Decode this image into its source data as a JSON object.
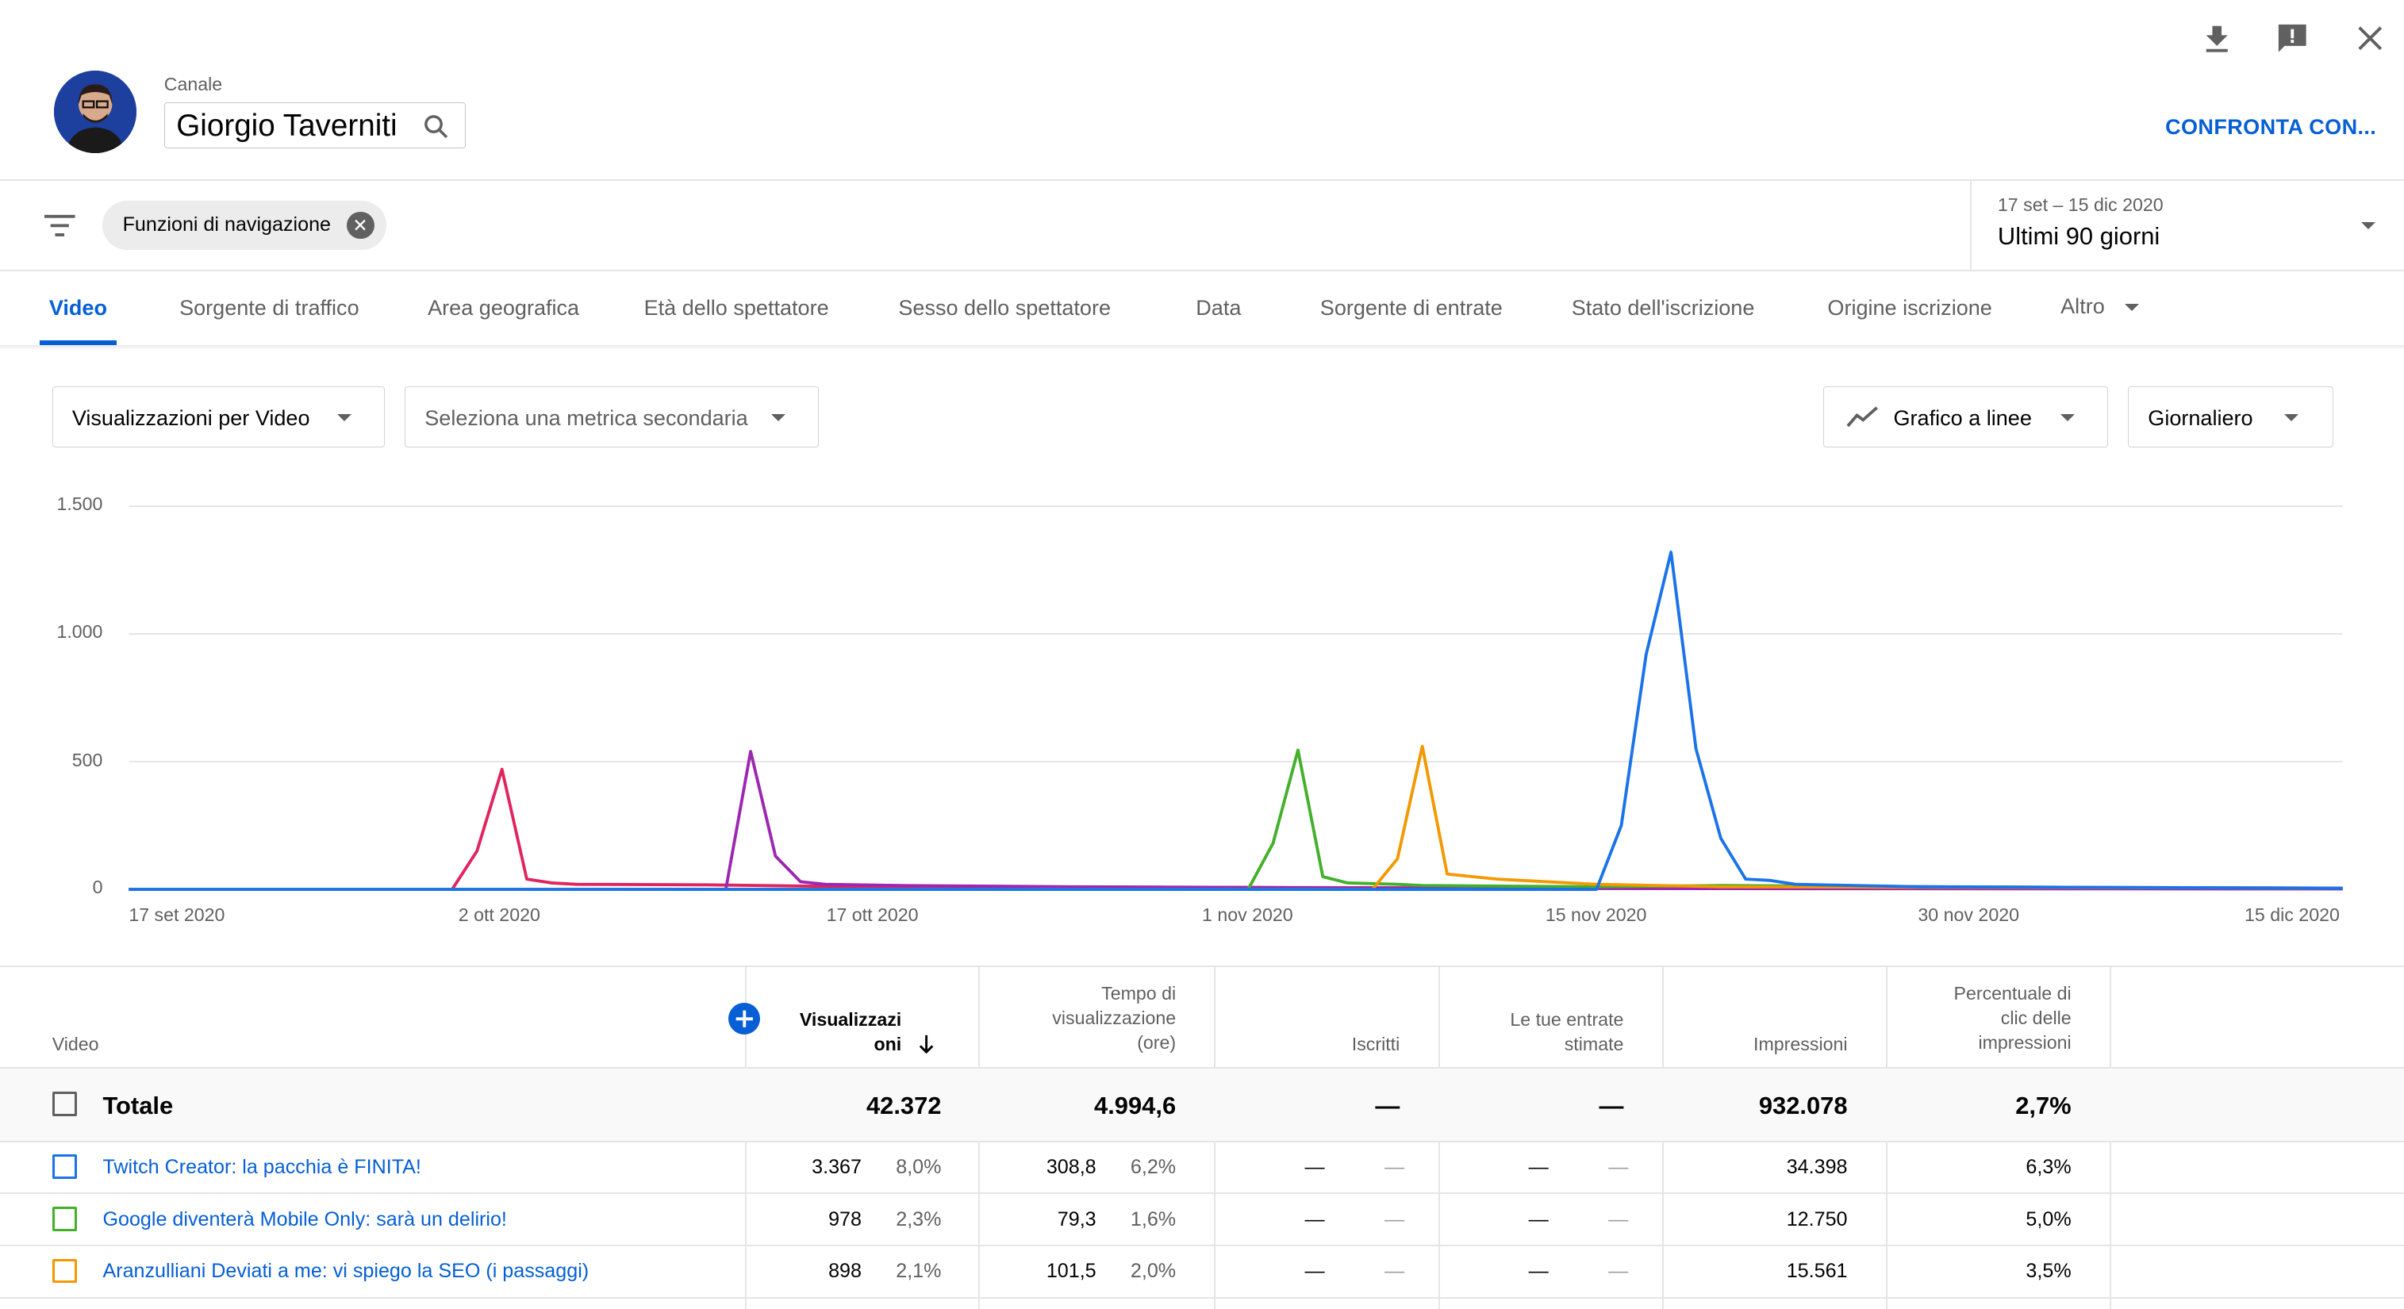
{
  "header": {
    "channel_label": "Canale",
    "channel_name": "Giorgio Taverniti",
    "compare_button": "CONFRONTA CON...",
    "icons": [
      "download-icon",
      "feedback-icon",
      "close-icon",
      "search-icon"
    ]
  },
  "filters": {
    "chip": "Funzioni di navigazione",
    "date_range": "17 set – 15 dic 2020",
    "date_preset": "Ultimi 90 giorni"
  },
  "tabs": [
    {
      "label": "Video",
      "active": true
    },
    {
      "label": "Sorgente di traffico"
    },
    {
      "label": "Area geografica"
    },
    {
      "label": "Età dello spettatore"
    },
    {
      "label": "Sesso dello spettatore"
    },
    {
      "label": "Data"
    },
    {
      "label": "Sorgente di entrate"
    },
    {
      "label": "Stato dell'iscrizione"
    },
    {
      "label": "Origine iscrizione"
    },
    {
      "label": "Altro"
    }
  ],
  "controls": {
    "metric": "Visualizzazioni per Video",
    "secondary_metric": "Seleziona una metrica secondaria",
    "chart_type": "Grafico a linee",
    "granularity": "Giornaliero"
  },
  "chart_data": {
    "type": "line",
    "y_ticks": [
      "1.500",
      "1.000",
      "500",
      "0"
    ],
    "ylim": [
      0,
      1500
    ],
    "x_tick_labels": [
      "17 set 2020",
      "2 ott 2020",
      "17 ott 2020",
      "1 nov 2020",
      "15 nov 2020",
      "30 nov 2020",
      "15 dic 2020"
    ],
    "x_range": [
      "2020-09-17",
      "2020-12-15"
    ],
    "grid": true,
    "series": [
      {
        "color": "#e0245e",
        "points": [
          [
            "2020-09-17",
            0
          ],
          [
            "2020-09-30",
            0
          ],
          [
            "2020-10-01",
            150
          ],
          [
            "2020-10-02",
            470
          ],
          [
            "2020-10-03",
            40
          ],
          [
            "2020-10-04",
            25
          ],
          [
            "2020-10-05",
            20
          ],
          [
            "2020-10-10",
            18
          ],
          [
            "2020-10-15",
            12
          ],
          [
            "2020-10-30",
            8
          ],
          [
            "2020-11-14",
            5
          ],
          [
            "2020-11-30",
            5
          ],
          [
            "2020-12-15",
            3
          ]
        ]
      },
      {
        "color": "#9c27b0",
        "points": [
          [
            "2020-09-17",
            0
          ],
          [
            "2020-10-11",
            0
          ],
          [
            "2020-10-12",
            540
          ],
          [
            "2020-10-13",
            130
          ],
          [
            "2020-10-14",
            30
          ],
          [
            "2020-10-15",
            20
          ],
          [
            "2020-10-18",
            15
          ],
          [
            "2020-10-25",
            10
          ],
          [
            "2020-11-01",
            8
          ],
          [
            "2020-11-05",
            5
          ],
          [
            "2020-11-20",
            3
          ],
          [
            "2020-12-15",
            2
          ]
        ]
      },
      {
        "color": "#43b02a",
        "points": [
          [
            "2020-09-17",
            0
          ],
          [
            "2020-11-01",
            0
          ],
          [
            "2020-11-02",
            180
          ],
          [
            "2020-11-03",
            545
          ],
          [
            "2020-11-04",
            50
          ],
          [
            "2020-11-05",
            25
          ],
          [
            "2020-11-07",
            20
          ],
          [
            "2020-11-08",
            15
          ],
          [
            "2020-11-15",
            10
          ],
          [
            "2020-11-20",
            15
          ],
          [
            "2020-11-25",
            12
          ],
          [
            "2020-12-05",
            8
          ],
          [
            "2020-12-15",
            5
          ]
        ]
      },
      {
        "color": "#f29900",
        "points": [
          [
            "2020-09-17",
            0
          ],
          [
            "2020-11-06",
            0
          ],
          [
            "2020-11-07",
            120
          ],
          [
            "2020-11-08",
            560
          ],
          [
            "2020-11-09",
            60
          ],
          [
            "2020-11-11",
            40
          ],
          [
            "2020-11-13",
            30
          ],
          [
            "2020-11-15",
            20
          ],
          [
            "2020-11-20",
            10
          ],
          [
            "2020-11-30",
            8
          ],
          [
            "2020-12-15",
            5
          ]
        ]
      },
      {
        "color": "#1a73e8",
        "points": [
          [
            "2020-09-17",
            0
          ],
          [
            "2020-11-15",
            0
          ],
          [
            "2020-11-16",
            250
          ],
          [
            "2020-11-17",
            920
          ],
          [
            "2020-11-18",
            1320
          ],
          [
            "2020-11-19",
            550
          ],
          [
            "2020-11-20",
            200
          ],
          [
            "2020-11-21",
            40
          ],
          [
            "2020-11-22",
            35
          ],
          [
            "2020-11-23",
            20
          ],
          [
            "2020-11-28",
            10
          ],
          [
            "2020-12-05",
            8
          ],
          [
            "2020-12-15",
            5
          ]
        ]
      }
    ]
  },
  "table": {
    "columns": [
      {
        "label": "Video"
      },
      {
        "label": "Visualizzazioni",
        "sorted": true
      },
      {
        "label": "Tempo di visualizzazione (ore)"
      },
      {
        "label": "Iscritti"
      },
      {
        "label": "Le tue entrate stimate"
      },
      {
        "label": "Impressioni"
      },
      {
        "label": "Percentuale di clic delle impressioni"
      }
    ],
    "header_lines": {
      "video": "Video",
      "views": [
        "Visualizzazi",
        "oni"
      ],
      "watch": [
        "Tempo di",
        "visualizzazione",
        "(ore)"
      ],
      "subs": "Iscritti",
      "revenue": [
        "Le tue entrate",
        "stimate"
      ],
      "impr": "Impressioni",
      "ctr": [
        "Percentuale di",
        "clic delle",
        "impressioni"
      ]
    },
    "total": {
      "label": "Totale",
      "views": "42.372",
      "watch": "4.994,6",
      "subs": "—",
      "revenue": "—",
      "impressions": "932.078",
      "ctr": "2,7%"
    },
    "rows": [
      {
        "title": "Twitch Creator: la pacchia è FINITA!",
        "color": "#1a73e8",
        "views": "3.367",
        "views_pct": "8,0%",
        "watch": "308,8",
        "watch_pct": "6,2%",
        "subs": "—",
        "subs_pct": "—",
        "revenue": "—",
        "revenue_pct": "—",
        "impressions": "34.398",
        "ctr": "6,3%"
      },
      {
        "title": "Google diventerà Mobile Only: sarà un delirio!",
        "color": "#43b02a",
        "views": "978",
        "views_pct": "2,3%",
        "watch": "79,3",
        "watch_pct": "1,6%",
        "subs": "—",
        "subs_pct": "—",
        "revenue": "—",
        "revenue_pct": "—",
        "impressions": "12.750",
        "ctr": "5,0%"
      },
      {
        "title": "Aranzulliani Deviati a me: vi spiego la SEO (i passaggi)",
        "color": "#f29900",
        "views": "898",
        "views_pct": "2,1%",
        "watch": "101,5",
        "watch_pct": "2,0%",
        "subs": "—",
        "subs_pct": "—",
        "revenue": "—",
        "revenue_pct": "—",
        "impressions": "15.561",
        "ctr": "3,5%"
      }
    ]
  }
}
